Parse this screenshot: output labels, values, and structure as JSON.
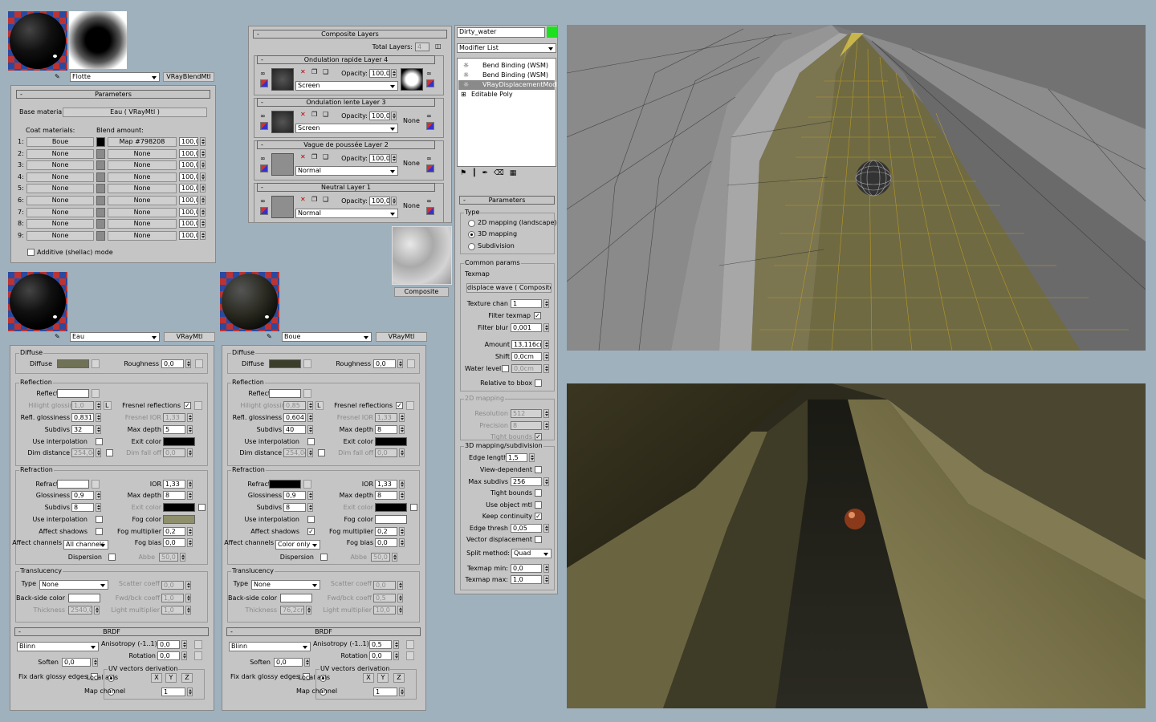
{
  "blend": {
    "mtl_name": "Flotte",
    "mtl_type": "VRayBlendMtl",
    "params_title": "Parameters",
    "base_label": "Base material:",
    "base_value": "Eau  ( VRayMtl )",
    "coat_label": "Coat materials:",
    "blend_label": "Blend amount:",
    "rows": [
      {
        "n": "1:",
        "coat": "Boue",
        "blend": "Map #798208",
        "amt": "100,0"
      },
      {
        "n": "2:",
        "coat": "None",
        "blend": "None",
        "amt": "100,0"
      },
      {
        "n": "3:",
        "coat": "None",
        "blend": "None",
        "amt": "100,0"
      },
      {
        "n": "4:",
        "coat": "None",
        "blend": "None",
        "amt": "100,0"
      },
      {
        "n": "5:",
        "coat": "None",
        "blend": "None",
        "amt": "100,0"
      },
      {
        "n": "6:",
        "coat": "None",
        "blend": "None",
        "amt": "100,0"
      },
      {
        "n": "7:",
        "coat": "None",
        "blend": "None",
        "amt": "100,0"
      },
      {
        "n": "8:",
        "coat": "None",
        "blend": "None",
        "amt": "100,0"
      },
      {
        "n": "9:",
        "coat": "None",
        "blend": "None",
        "amt": "100,0"
      }
    ],
    "additive": "Additive (shellac) mode"
  },
  "composite": {
    "title": "Composite Layers",
    "total_label": "Total Layers:",
    "total": "4",
    "opacity_label": "Opacity:",
    "layers": [
      {
        "name": "Ondulation rapide Layer 4",
        "opacity": "100,0",
        "mode": "Screen",
        "mask": ""
      },
      {
        "name": "Ondulation lente Layer 3",
        "opacity": "100,0",
        "mode": "Screen",
        "mask": "None"
      },
      {
        "name": "Vague de poussée Layer 2",
        "opacity": "100,0",
        "mode": "Normal",
        "mask": "None"
      },
      {
        "name": "Neutral Layer 1",
        "opacity": "100,0",
        "mode": "Normal",
        "mask": "None"
      }
    ],
    "preview_label": "Composite"
  },
  "modifier": {
    "object_name": "Dirty_water",
    "list_label": "Modifier List",
    "stack": [
      "Bend Binding (WSM)",
      "Bend Binding (WSM)",
      "VRayDisplacementMod",
      "Editable Poly"
    ],
    "color": "#1fe01f"
  },
  "displace": {
    "params_title": "Parameters",
    "type_label": "Type",
    "types": [
      "2D mapping (landscape)",
      "3D mapping",
      "Subdivision"
    ],
    "common_label": "Common params",
    "texmap_label": "Texmap",
    "texmap_value": "displace wave  ( Composite )",
    "texture_chan_label": "Texture chan",
    "texture_chan": "1",
    "filter_texmap_label": "Filter texmap",
    "filter_blur_label": "Filter blur",
    "filter_blur": "0,001",
    "amount_label": "Amount",
    "amount": "13,116cm",
    "shift_label": "Shift",
    "shift": "0,0cm",
    "water_label": "Water level",
    "water": "0,0cm",
    "relative_label": "Relative to bbox",
    "map2d_label": "2D mapping",
    "resolution_label": "Resolution",
    "resolution": "512",
    "precision_label": "Precision",
    "precision": "8",
    "tight_label": "Tight bounds",
    "map3d_label": "3D mapping/subdivision",
    "edge_label": "Edge length",
    "edge": "1,5",
    "view_label": "View-dependent",
    "maxsub_label": "Max subdivs",
    "maxsub": "256",
    "tight2_label": "Tight bounds",
    "useobj_label": "Use object mtl",
    "keep_label": "Keep continuity",
    "edgethresh_label": "Edge thresh",
    "edgethresh": "0,05",
    "vector_label": "Vector displacement",
    "split_label": "Split method:",
    "split": "Quad",
    "tmin_label": "Texmap min:",
    "tmin": "0,0",
    "tmax_label": "Texmap max:",
    "tmax": "1,0"
  },
  "eau": {
    "mtl_name": "Eau",
    "mtl_type": "VRayMtl",
    "diffuse_color": "#707256",
    "refract_color": "#ffffff",
    "fog_color": "#8e8f6c",
    "ior": "1,33",
    "rough": "0,0",
    "hilight": "1,0",
    "refl_gloss": "0,831",
    "subdivs": "32",
    "max_depth": "5",
    "fresnel_ior": "1,33",
    "dim": "254,0c",
    "dim_fall": "0,0",
    "gloss": "0,9",
    "r_max": "8",
    "r_sub": "8",
    "fog_mult": "0,2",
    "fog_bias": "0,0",
    "channels": "All channels",
    "abbe": "50,0",
    "trans": "None",
    "scatter": "0,0",
    "fwd": "1,0",
    "thick": "2540,0",
    "light": "1,0",
    "brdf": "Blinn",
    "aniso": "0,0",
    "rot": "0,0",
    "soften": "0,0",
    "map_ch": "1"
  },
  "boue": {
    "mtl_name": "Boue",
    "mtl_type": "VRayMtl",
    "diffuse_color": "#3c3e2c",
    "refract_color": "#000000",
    "fog_color": "#ffffff",
    "ior": "1,33",
    "rough": "0,0",
    "hilight": "0,85",
    "refl_gloss": "0,604",
    "subdivs": "40",
    "max_depth": "8",
    "fresnel_ior": "1,33",
    "dim": "254,0c",
    "dim_fall": "0,0",
    "gloss": "0,9",
    "r_max": "8",
    "r_sub": "8",
    "fog_mult": "0,2",
    "fog_bias": "0,0",
    "channels": "Color only",
    "abbe": "50,0",
    "trans": "None",
    "scatter": "0,0",
    "fwd": "0,5",
    "thick": "76,2cm",
    "light": "10,0",
    "brdf": "Blinn",
    "aniso": "0,5",
    "rot": "0,0",
    "soften": "0,0",
    "map_ch": "1"
  },
  "labels": {
    "diffuse_grp": "Diffuse",
    "diffuse": "Diffuse",
    "roughness": "Roughness",
    "reflection": "Reflection",
    "reflect": "Reflect",
    "hilight": "Hilight glossiness",
    "refl_gloss": "Refl. glossiness",
    "subdivs": "Subdivs",
    "use_interp": "Use interpolation",
    "dim": "Dim distance",
    "fresnel": "Fresnel reflections",
    "fresnel_ior": "Fresnel IOR",
    "max_depth": "Max depth",
    "exit": "Exit color",
    "dim_fall": "Dim fall off",
    "refraction": "Refraction",
    "refract": "Refract",
    "gloss": "Glossiness",
    "affect_sh": "Affect shadows",
    "affect_ch": "Affect channels",
    "ior": "IOR",
    "fog_color": "Fog color",
    "fog_mult": "Fog multiplier",
    "fog_bias": "Fog bias",
    "dispersion": "Dispersion",
    "abbe": "Abbe",
    "translucency": "Translucency",
    "type": "Type",
    "back": "Back-side color",
    "thickness": "Thickness",
    "scatter": "Scatter coeff",
    "fwd": "Fwd/bck coeff",
    "light": "Light multiplier",
    "brdf": "BRDF",
    "aniso": "Anisotropy (-1..1)",
    "rotation": "Rotation",
    "soften": "Soften",
    "fix": "Fix dark glossy edges",
    "uv": "UV vectors derivation",
    "local": "Local axis",
    "map_ch": "Map channel",
    "x": "X",
    "y": "Y",
    "z": "Z"
  }
}
